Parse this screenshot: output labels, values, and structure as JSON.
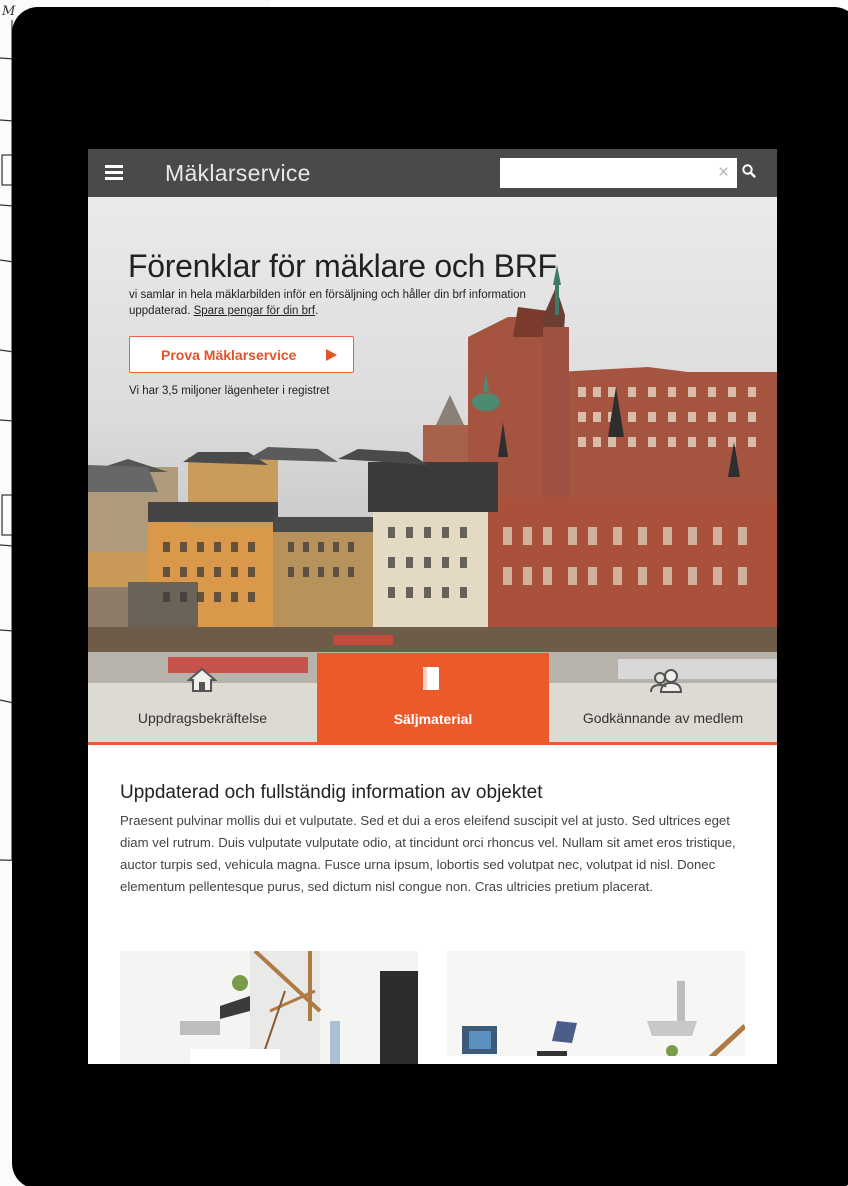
{
  "app": {
    "title": "Mäklarservice",
    "menu_icon": "hamburger-icon",
    "search": {
      "placeholder": "",
      "value": "",
      "clear_icon": "close-icon",
      "button_icon": "search-icon"
    }
  },
  "hero": {
    "title": "Förenklar för mäklare och BRF",
    "subtitle": "vi samlar in hela mäklarbilden inför en försäljning och håller din brf information uppdaterad.",
    "subtitle_link": "Spara pengar för din brf",
    "subtitle_end": ".",
    "cta_label": "Prova Mäklarservice",
    "stat": "Vi har 3,5 miljoner lägenheter i registret"
  },
  "tabs": [
    {
      "label": "Uppdragsbekräftelse",
      "icon": "house-icon",
      "active": false
    },
    {
      "label": "Säljmaterial",
      "icon": "book-icon",
      "active": true
    },
    {
      "label": "Godkännande av medlem",
      "icon": "users-icon",
      "active": false
    }
  ],
  "content": {
    "title": "Uppdaterad och fullständig information av objektet",
    "body": "Praesent pulvinar mollis dui et vulputate. Sed et dui a eros eleifend suscipit vel at justo. Sed ultrices eget diam vel rutrum. Duis vulputate vulputate odio, at tincidunt orci rhoncus vel. Nullam sit amet eros tristique, auctor turpis sed, vehicula magna. Fusce urna ipsum, lobortis sed volutpat nec, volutpat id nisl. Donec elementum pellentesque purus, sed dictum nisl congue non. Cras ultricies pretium placerat."
  },
  "colors": {
    "accent": "#ec5a2c",
    "appbar": "#4a4a4a",
    "device": "#000000"
  }
}
